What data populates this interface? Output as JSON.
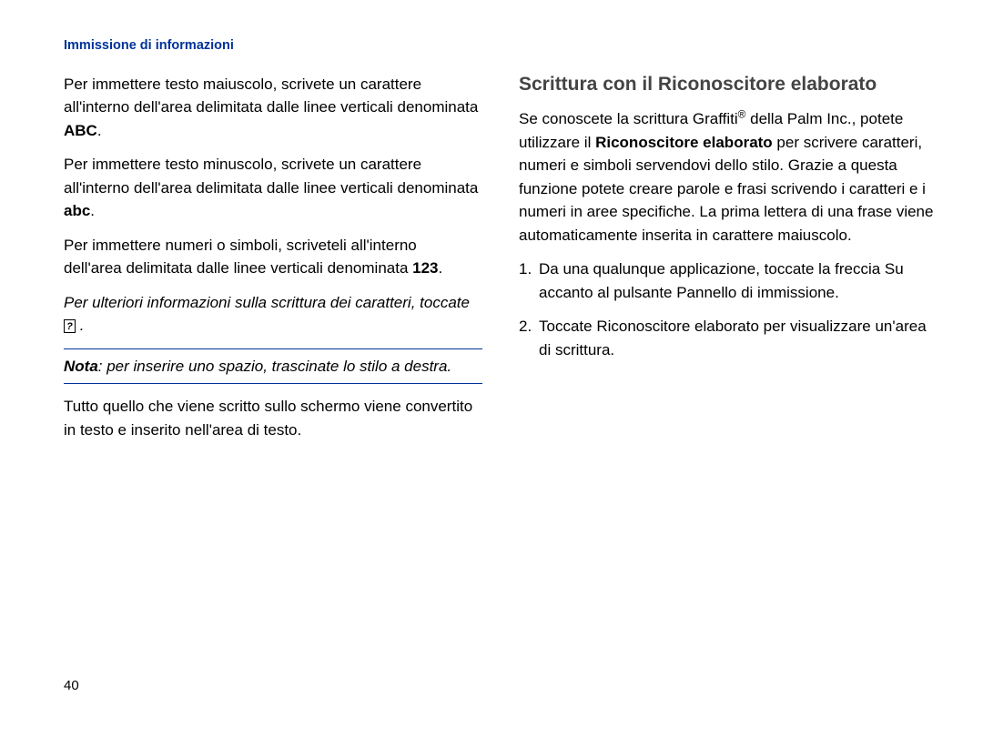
{
  "header": "Immissione di informazioni",
  "left": {
    "p1_a": "Per immettere testo maiuscolo, scrivete un carattere all'interno dell'area delimitata dalle linee verticali denominata ",
    "p1_b": "ABC",
    "p1_c": ".",
    "p2_a": "Per immettere testo minuscolo, scrivete un carattere all'interno dell'area delimitata dalle linee verticali denominata ",
    "p2_b": "abc",
    "p2_c": ".",
    "p3_a": "Per immettere numeri o simboli, scriveteli all'interno dell'area delimitata dalle linee verticali denominata ",
    "p3_b": "123",
    "p3_c": ".",
    "p4_a": "Per ulteriori informazioni sulla scrittura dei caratteri, toccate ",
    "p4_b": ".",
    "q_mark": "?",
    "note_label": "Nota",
    "note_text": ": per inserire uno spazio, trascinate lo stilo a destra.",
    "p5": "Tutto quello che viene scritto sullo schermo viene convertito in testo e inserito nell'area di testo."
  },
  "right": {
    "title": "Scrittura con il Riconoscitore elaborato",
    "intro_a": "Se conoscete la scrittura Graffiti",
    "intro_sup": "®",
    "intro_b": " della Palm Inc., potete utilizzare il ",
    "intro_bold": "Riconoscitore elaborato",
    "intro_c": " per scrivere caratteri, numeri e simboli servendovi dello stilo. Grazie a questa funzione potete creare parole e frasi scrivendo i caratteri e i numeri in aree specifiche. La prima lettera di una frase viene automaticamente inserita in carattere maiuscolo.",
    "li1_num": "1.",
    "li1": "Da una qualunque applicazione, toccate la freccia Su accanto al pulsante Pannello di immissione.",
    "li2_num": "2.",
    "li2_a": "Toccate ",
    "li2_b": "Riconoscitore elaborato",
    "li2_c": " per visualizzare un'area di scrittura."
  },
  "page_number": "40"
}
